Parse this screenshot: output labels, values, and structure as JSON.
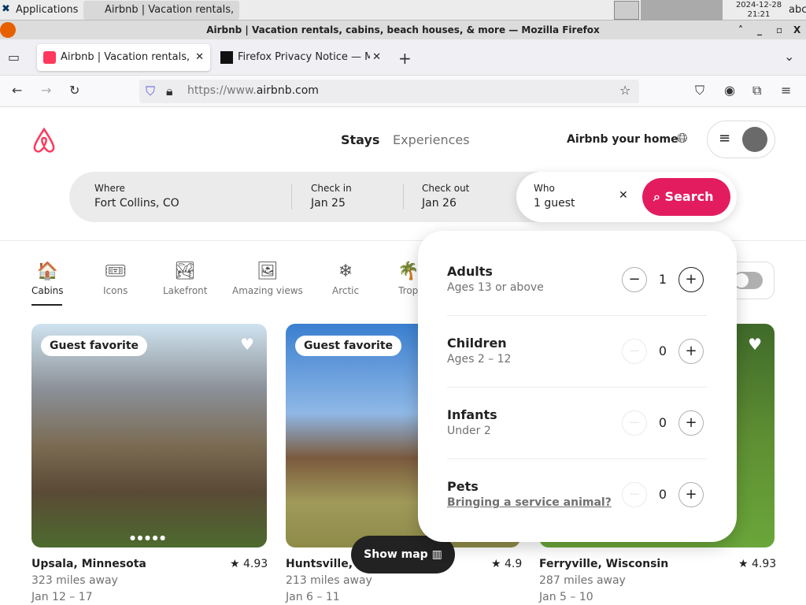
{
  "taskbar": {
    "apps": "Applications",
    "window": "Airbnb | Vacation rentals, ...",
    "date": "2024-12-28",
    "time": "21:21",
    "kbd": "abc"
  },
  "window": {
    "title": "Airbnb | Vacation rentals, cabins, beach houses, & more — Mozilla Firefox"
  },
  "tabs": [
    {
      "label": "Airbnb | Vacation rentals, c"
    },
    {
      "label": "Firefox Privacy Notice — M"
    }
  ],
  "url": {
    "prefix": "https://www.",
    "domain": "airbnb.com"
  },
  "header": {
    "nav": [
      "Stays",
      "Experiences"
    ],
    "host": "Airbnb your home"
  },
  "search": {
    "where_label": "Where",
    "where": "Fort Collins, CO",
    "checkin_label": "Check in",
    "checkin": "Jan 25",
    "checkout_label": "Check out",
    "checkout": "Jan 26",
    "who_label": "Who",
    "who": "1 guest",
    "button": "Search"
  },
  "categories": [
    {
      "label": "Cabins",
      "icon": "🏠"
    },
    {
      "label": "Icons",
      "icon": "🎟"
    },
    {
      "label": "Lakefront",
      "icon": "🏞"
    },
    {
      "label": "Amazing views",
      "icon": "🖼"
    },
    {
      "label": "Arctic",
      "icon": "❄"
    },
    {
      "label": "Trop",
      "icon": "🌴"
    }
  ],
  "guests": [
    {
      "label": "Adults",
      "desc": "Ages 13 or above",
      "value": "1",
      "minus_enabled": true
    },
    {
      "label": "Children",
      "desc": "Ages 2 – 12",
      "value": "0",
      "minus_enabled": false
    },
    {
      "label": "Infants",
      "desc": "Under 2",
      "value": "0",
      "minus_enabled": false
    },
    {
      "label": "Pets",
      "desc": "Bringing a service animal?",
      "value": "0",
      "minus_enabled": false
    }
  ],
  "listings": [
    {
      "badge": "Guest favorite",
      "title": "Upsala, Minnesota",
      "rating": "4.93",
      "distance": "323 miles away",
      "dates": "Jan 12 – 17"
    },
    {
      "badge": "Guest favorite",
      "title": "Huntsville, M",
      "rating": "4.9",
      "distance": "213 miles away",
      "dates": "Jan 6 – 11"
    },
    {
      "title": "Ferryville, Wisconsin",
      "rating": "4.93",
      "distance": "287 miles away",
      "dates": "Jan 5 – 10"
    }
  ],
  "show_map": "Show map",
  "colors": {
    "brand": "#ff385c",
    "search": "#e31c5f"
  }
}
